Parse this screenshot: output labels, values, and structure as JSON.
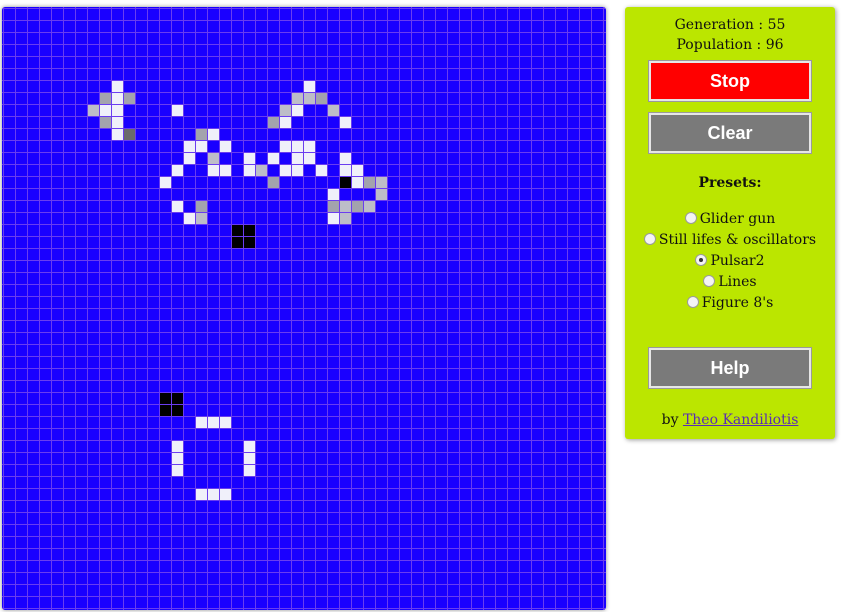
{
  "board": {
    "columns": 50,
    "rows": 50,
    "colors": {
      "background": "#1a00ff",
      "grid_line": "#6a3df0",
      "cell_new": "#f0f0fa",
      "cell_light": "#bdbdc8",
      "cell_mid": "#a3a3ad",
      "cell_dark": "#6a6a6a",
      "cell_old": "#000000"
    },
    "cells": [
      [
        9,
        6,
        "new"
      ],
      [
        8,
        7,
        "mid"
      ],
      [
        9,
        7,
        "new"
      ],
      [
        10,
        7,
        "mid"
      ],
      [
        7,
        8,
        "light"
      ],
      [
        8,
        8,
        "new"
      ],
      [
        9,
        8,
        "new"
      ],
      [
        14,
        8,
        "new"
      ],
      [
        8,
        9,
        "mid"
      ],
      [
        9,
        9,
        "new"
      ],
      [
        9,
        10,
        "new"
      ],
      [
        10,
        10,
        "dark"
      ],
      [
        25,
        6,
        "new"
      ],
      [
        24,
        7,
        "light"
      ],
      [
        25,
        7,
        "light"
      ],
      [
        26,
        7,
        "mid"
      ],
      [
        23,
        8,
        "light"
      ],
      [
        24,
        8,
        "new"
      ],
      [
        27,
        8,
        "light"
      ],
      [
        22,
        9,
        "mid"
      ],
      [
        23,
        9,
        "new"
      ],
      [
        28,
        9,
        "new"
      ],
      [
        16,
        10,
        "mid"
      ],
      [
        17,
        10,
        "new"
      ],
      [
        15,
        11,
        "new"
      ],
      [
        16,
        11,
        "new"
      ],
      [
        18,
        11,
        "new"
      ],
      [
        23,
        11,
        "new"
      ],
      [
        24,
        11,
        "new"
      ],
      [
        25,
        11,
        "new"
      ],
      [
        15,
        12,
        "new"
      ],
      [
        17,
        12,
        "light"
      ],
      [
        20,
        12,
        "new"
      ],
      [
        22,
        12,
        "new"
      ],
      [
        24,
        12,
        "new"
      ],
      [
        25,
        12,
        "new"
      ],
      [
        28,
        12,
        "new"
      ],
      [
        14,
        13,
        "new"
      ],
      [
        17,
        13,
        "new"
      ],
      [
        18,
        13,
        "new"
      ],
      [
        20,
        13,
        "new"
      ],
      [
        21,
        13,
        "light"
      ],
      [
        23,
        13,
        "new"
      ],
      [
        24,
        13,
        "new"
      ],
      [
        26,
        13,
        "new"
      ],
      [
        28,
        13,
        "new"
      ],
      [
        29,
        13,
        "new"
      ],
      [
        13,
        14,
        "new"
      ],
      [
        22,
        14,
        "mid"
      ],
      [
        28,
        14,
        "old"
      ],
      [
        29,
        14,
        "new"
      ],
      [
        30,
        14,
        "mid"
      ],
      [
        31,
        14,
        "light"
      ],
      [
        27,
        15,
        "new"
      ],
      [
        31,
        15,
        "light"
      ],
      [
        14,
        16,
        "new"
      ],
      [
        16,
        16,
        "mid"
      ],
      [
        27,
        16,
        "mid"
      ],
      [
        28,
        16,
        "light"
      ],
      [
        29,
        16,
        "mid"
      ],
      [
        30,
        16,
        "light"
      ],
      [
        15,
        17,
        "new"
      ],
      [
        16,
        17,
        "light"
      ],
      [
        27,
        17,
        "new"
      ],
      [
        28,
        17,
        "light"
      ],
      [
        19,
        18,
        "old"
      ],
      [
        20,
        18,
        "old"
      ],
      [
        19,
        19,
        "old"
      ],
      [
        20,
        19,
        "old"
      ],
      [
        13,
        32,
        "old"
      ],
      [
        14,
        32,
        "old"
      ],
      [
        13,
        33,
        "old"
      ],
      [
        14,
        33,
        "old"
      ],
      [
        16,
        34,
        "new"
      ],
      [
        17,
        34,
        "new"
      ],
      [
        18,
        34,
        "new"
      ],
      [
        14,
        36,
        "new"
      ],
      [
        20,
        36,
        "new"
      ],
      [
        14,
        37,
        "new"
      ],
      [
        20,
        37,
        "new"
      ],
      [
        14,
        38,
        "new"
      ],
      [
        20,
        38,
        "new"
      ],
      [
        16,
        40,
        "new"
      ],
      [
        17,
        40,
        "new"
      ],
      [
        18,
        40,
        "new"
      ]
    ]
  },
  "stats": {
    "generation": "Generation : 55",
    "population": "Population : 96"
  },
  "buttons": {
    "stop": "Stop",
    "clear": "Clear",
    "help": "Help"
  },
  "presets": {
    "title": "Presets:",
    "options": [
      {
        "label": "Glider gun",
        "checked": false
      },
      {
        "label": "Still lifes & oscillators",
        "checked": false
      },
      {
        "label": "Pulsar2",
        "checked": true
      },
      {
        "label": "Lines",
        "checked": false
      },
      {
        "label": "Figure 8's",
        "checked": false
      }
    ]
  },
  "credit": {
    "prefix": "by",
    "author": "Theo Kandiliotis"
  }
}
